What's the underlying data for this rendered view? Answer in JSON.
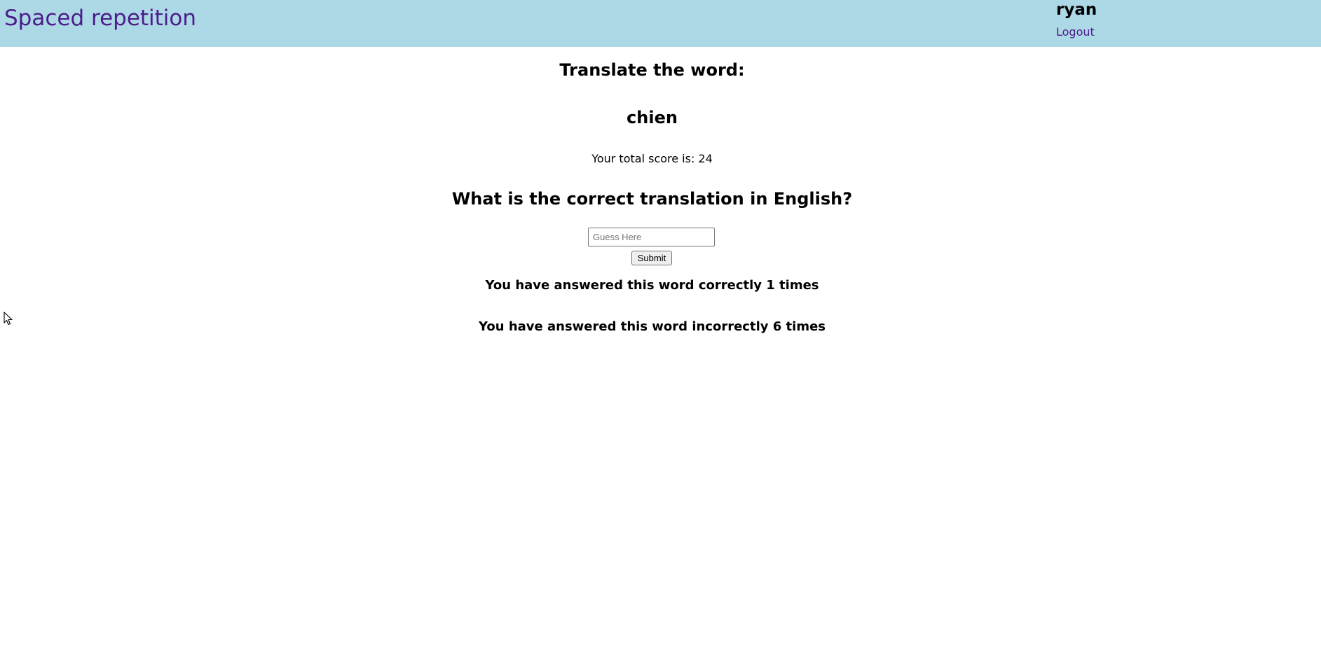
{
  "header": {
    "title": "Spaced repetition",
    "user_name": "ryan",
    "logout_label": "Logout"
  },
  "learning": {
    "prompt_heading": "Translate the word:",
    "word": "chien",
    "score_text": "Your total score is: 24",
    "question": "What is the correct translation in English?",
    "guess_placeholder": "Guess Here",
    "submit_label": "Submit",
    "correct_count_text": "You have answered this word correctly 1 times",
    "incorrect_count_text": "You have answered this word incorrectly 6 times"
  },
  "colors": {
    "header_background": "#add8e6",
    "brand_purple": "#4b1d8b"
  },
  "icons": {
    "cursor": "mouse-pointer-icon"
  }
}
